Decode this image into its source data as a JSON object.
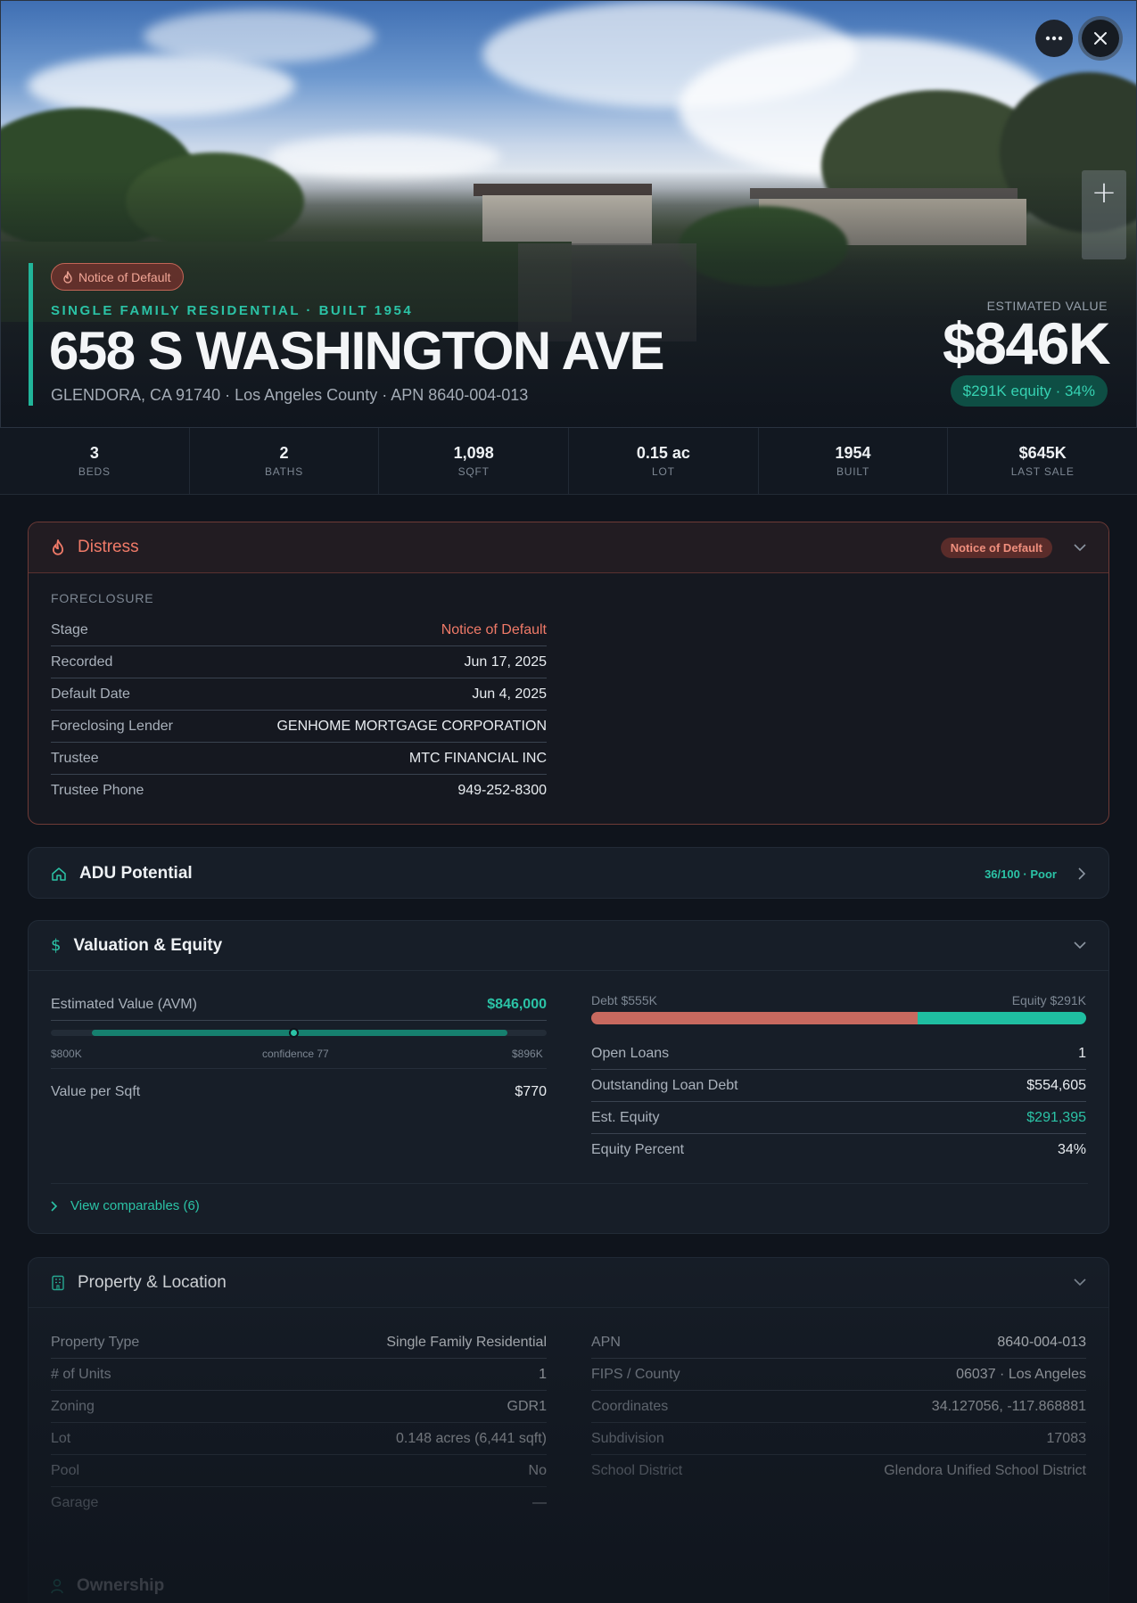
{
  "hero": {
    "status_badge": "Notice of Default",
    "eyebrow": "SINGLE FAMILY RESIDENTIAL · BUILT 1954",
    "address": "658 S WASHINGTON AVE",
    "location": "GLENDORA, CA 91740 · Los Angeles County · APN 8640-004-013",
    "estimated_value_label": "ESTIMATED VALUE",
    "estimated_value": "$846K",
    "equity_badge": "$291K equity · 34%"
  },
  "stats": [
    {
      "value": "3",
      "label": "BEDS"
    },
    {
      "value": "2",
      "label": "BATHS"
    },
    {
      "value": "1,098",
      "label": "SQFT"
    },
    {
      "value": "0.15 ac",
      "label": "LOT"
    },
    {
      "value": "1954",
      "label": "BUILT"
    },
    {
      "value": "$645K",
      "label": "LAST SALE"
    }
  ],
  "distress": {
    "title": "Distress",
    "badge": "Notice of Default",
    "section": "FORECLOSURE",
    "rows": [
      {
        "k": "Stage",
        "v": "Notice of Default"
      },
      {
        "k": "Recorded",
        "v": "Jun 17, 2025"
      },
      {
        "k": "Default Date",
        "v": "Jun 4, 2025"
      },
      {
        "k": "Foreclosing Lender",
        "v": "GENHOME MORTGAGE CORPORATION"
      },
      {
        "k": "Trustee",
        "v": "MTC FINANCIAL INC"
      },
      {
        "k": "Trustee Phone",
        "v": "949-252-8300"
      }
    ]
  },
  "adu": {
    "title": "ADU Potential",
    "score": "36/100 · Poor"
  },
  "valuation": {
    "title": "Valuation & Equity",
    "avm_label": "Estimated Value (AVM)",
    "avm_value": "$846,000",
    "range_low": "$800K",
    "confidence": "confidence 77",
    "range_high": "$896K",
    "avm_position": 0.49,
    "value_per_sqft_label": "Value per Sqft",
    "value_per_sqft": "$770",
    "debt_label": "Debt $555K",
    "equity_label": "Equity $291K",
    "debt_share": 0.66,
    "rows": [
      {
        "k": "Open Loans",
        "v": "1"
      },
      {
        "k": "Outstanding Loan Debt",
        "v": "$554,605"
      },
      {
        "k": "Est. Equity",
        "v": "$291,395"
      },
      {
        "k": "Equity Percent",
        "v": "34%"
      }
    ],
    "comparables_link": "View comparables (6)"
  },
  "property": {
    "title": "Property & Location",
    "left": [
      {
        "k": "Property Type",
        "v": "Single Family Residential"
      },
      {
        "k": "# of Units",
        "v": "1"
      },
      {
        "k": "Zoning",
        "v": "GDR1"
      },
      {
        "k": "Lot",
        "v": "0.148 acres (6,441 sqft)"
      },
      {
        "k": "Pool",
        "v": "No"
      },
      {
        "k": "Garage",
        "v": "—"
      }
    ],
    "right": [
      {
        "k": "APN",
        "v": "8640-004-013"
      },
      {
        "k": "FIPS / County",
        "v": "06037 · Los Angeles"
      },
      {
        "k": "Coordinates",
        "v": "34.127056, -117.868881"
      },
      {
        "k": "Subdivision",
        "v": "17083"
      },
      {
        "k": "School District",
        "v": "Glendora Unified School District"
      }
    ]
  },
  "ownership": {
    "title": "Ownership"
  },
  "colors": {
    "accent": "#2bc3a6",
    "distress": "#f07a68",
    "debt": "#c8695f",
    "background": "#0f141c"
  }
}
